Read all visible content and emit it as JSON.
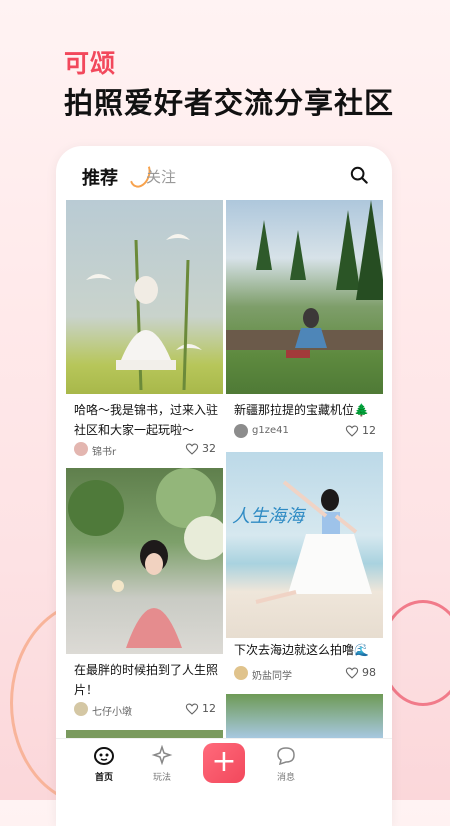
{
  "promo": {
    "brand": "可颂",
    "slogan": "拍照爱好者交流分享社区"
  },
  "nav": {
    "tab_recommend": "推荐",
    "tab_follow": "关注"
  },
  "feed": [
    {
      "title": "哈咯～我是锦书，过来入驻社区和大家一起玩啦～",
      "author": "锦书r",
      "likes": "32"
    },
    {
      "title": "新疆那拉提的宝藏机位🌲",
      "author": "g1ze41",
      "likes": "12"
    },
    {
      "title": "在最胖的时候拍到了人生照片！",
      "author": "七仔小墩",
      "likes": "12"
    },
    {
      "title": "下次去海边就这么拍噜🌊",
      "author": "奶盐同学",
      "likes": "98"
    }
  ],
  "sea_sign": "人生海海",
  "bottom_nav": {
    "home": "首页",
    "play": "玩法",
    "message": "消息"
  },
  "colors": {
    "accent": "#f2485c",
    "plus_button": "#f2485c"
  }
}
